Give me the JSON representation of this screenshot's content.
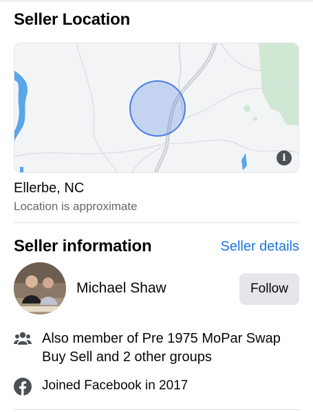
{
  "location_section": {
    "title": "Seller Location",
    "city": "Ellerbe, NC",
    "approx_note": "Location is approximate",
    "map_info_icon": "info-icon"
  },
  "seller_section": {
    "title": "Seller information",
    "details_link": "Seller details",
    "name": "Michael Shaw",
    "follow_label": "Follow",
    "groups_icon": "groups-icon",
    "groups_text": "Also member of Pre 1975 MoPar Swap Buy Sell and 2 other groups",
    "joined_icon": "facebook-icon",
    "joined_text": "Joined Facebook in 2017"
  },
  "colors": {
    "link": "#1b74e4",
    "secondary_text": "#65676b",
    "button_bg": "#e4e6eb",
    "map_circle": "#4a7de0"
  }
}
